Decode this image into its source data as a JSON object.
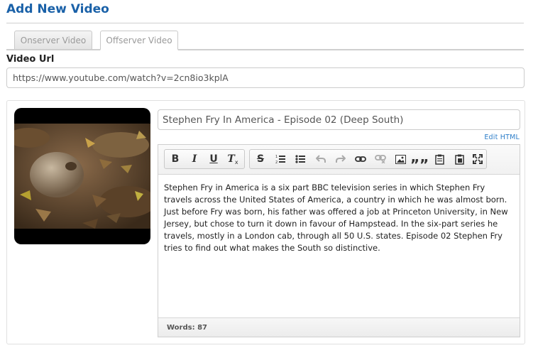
{
  "page": {
    "title": "Add New Video"
  },
  "tabs": [
    {
      "label": "Onserver Video",
      "active": false
    },
    {
      "label": "Offserver Video",
      "active": true
    }
  ],
  "url_field": {
    "label": "Video Url",
    "value": "https://www.youtube.com/watch?v=2cn8io3kplA"
  },
  "video": {
    "title": "Stephen Fry In America - Episode 02 (Deep South)",
    "edit_html_label": "Edit HTML",
    "description": "Stephen Fry in America is a six part BBC television series in which Stephen Fry travels across the United States of America, a country in which he was almost born. Just before Fry was born, his father was offered a job at Princeton University, in New Jersey, but chose to turn it down in favour of Hampstead. In the six-part series he travels, mostly in a London cab, through all 50 U.S. states. Episode 02 Stephen Fry tries to find out what makes the South so distinctive.",
    "word_count_label": "Words: 87"
  },
  "toolbar": {
    "bold": "B",
    "italic": "I",
    "underline": "U",
    "remove_format": "T",
    "strike": "S",
    "blockquote": "””",
    "icons": [
      "bold-icon",
      "italic-icon",
      "underline-icon",
      "remove-format-icon",
      "strikethrough-icon",
      "ordered-list-icon",
      "unordered-list-icon",
      "undo-icon",
      "redo-icon",
      "link-icon",
      "unlink-icon",
      "image-icon",
      "blockquote-icon",
      "paste-icon",
      "paste-word-icon",
      "fullscreen-icon"
    ]
  }
}
